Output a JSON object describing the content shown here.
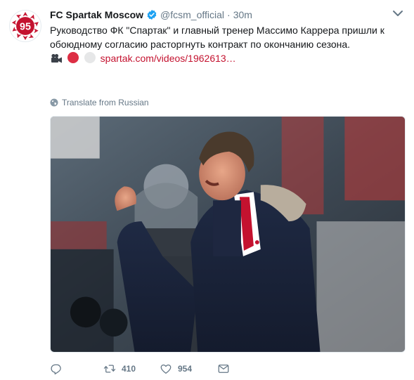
{
  "tweet": {
    "display_name": "FC Spartak Moscow",
    "handle": "@fcsm_official",
    "separator": "·",
    "time": "30m",
    "avatar_number": "95",
    "text_line1": "Руководство ФК \"Спартак\" и главный тренер Массимо Каррера пришли к",
    "text_line2": "обоюдному согласию расторгнуть контракт по окончанию сезона.",
    "link_text": "spartak.com/videos/1962613…",
    "translate_label": "Translate from Russian",
    "retweet_count": "410",
    "like_count": "954"
  },
  "icons": {
    "verified": "verified-badge-icon",
    "caret": "chevron-down-icon",
    "globe": "globe-icon",
    "reply": "reply-icon",
    "retweet": "retweet-icon",
    "like": "heart-icon",
    "message": "envelope-icon",
    "emoji": [
      "movie-camera-icon",
      "red-circle-icon",
      "white-circle-icon"
    ]
  },
  "colors": {
    "brand_red": "#c4122f",
    "verified_blue": "#1da1f2",
    "meta_gray": "#657786",
    "text": "#14171a"
  }
}
